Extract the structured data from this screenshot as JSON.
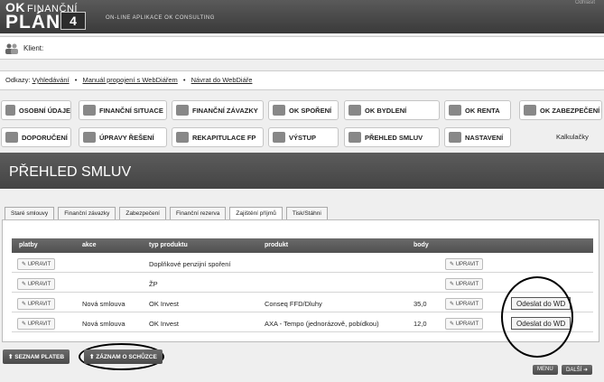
{
  "header": {
    "logo_ok": "OK",
    "logo_fin": "FINANČNÍ",
    "logo_plan": "PLÁN",
    "logo_badge": "4",
    "tagline": "ON-LINE APLIKACE OK CONSULTING",
    "top_right": "Odhlásit"
  },
  "client": {
    "label": "Klient:"
  },
  "links": {
    "prefix": "Odkazy:",
    "items": [
      "Vyhledávání",
      "Manuál propojení s WebDiářem",
      "Návrat do WebDiáře"
    ]
  },
  "nav_row1": [
    "OSOBNÍ ÚDAJE",
    "FINANČNÍ SITUACE",
    "FINANČNÍ ZÁVAZKY",
    "OK SPOŘENÍ",
    "OK BYDLENÍ",
    "OK RENTA",
    "OK ZABEZPEČENÍ"
  ],
  "nav_row2": [
    "DOPORUČENÍ",
    "ÚPRAVY ŘEŠENÍ",
    "REKAPITULACE FP",
    "VÝSTUP",
    "PŘEHLED SMLUV",
    "NASTAVENÍ"
  ],
  "kalkulacky": "Kalkulačky",
  "section_title": "PŘEHLED SMLUV",
  "tabs": [
    "Staré smlouvy",
    "Finanční závazky",
    "Zabezpečení",
    "Finanční rezerva",
    "Zajištění příjmů",
    "Tisk/Stáhni"
  ],
  "table": {
    "headers": [
      "platby",
      "akce",
      "typ produktu",
      "produkt",
      "body"
    ],
    "rows": [
      {
        "edit": "UPRAVIT",
        "akce": "",
        "typ": "Doplňkové penzijní spoření",
        "produkt": "",
        "body": "",
        "edit2": "UPRAVIT",
        "send": ""
      },
      {
        "edit": "UPRAVIT",
        "akce": "",
        "typ": "ŽP",
        "produkt": "",
        "body": "",
        "edit2": "UPRAVIT",
        "send": ""
      },
      {
        "edit": "UPRAVIT",
        "akce": "Nová smlouva",
        "typ": "OK Invest",
        "produkt": "Conseq FFD/Dluhy",
        "body": "35,0",
        "edit2": "UPRAVIT",
        "send": "Odeslat do WD"
      },
      {
        "edit": "UPRAVIT",
        "akce": "Nová smlouva",
        "typ": "OK Invest",
        "produkt": "AXA - Tempo (jednorázově, pobídkou)",
        "body": "12,0",
        "edit2": "UPRAVIT",
        "send": "Odeslat do WD"
      }
    ]
  },
  "bottom": {
    "seznam": "SEZNAM PLATEB",
    "zaznam": "ZÁZNAM O SCHŮZCE",
    "menu": "MENU",
    "dalsi": "DALŠÍ"
  }
}
